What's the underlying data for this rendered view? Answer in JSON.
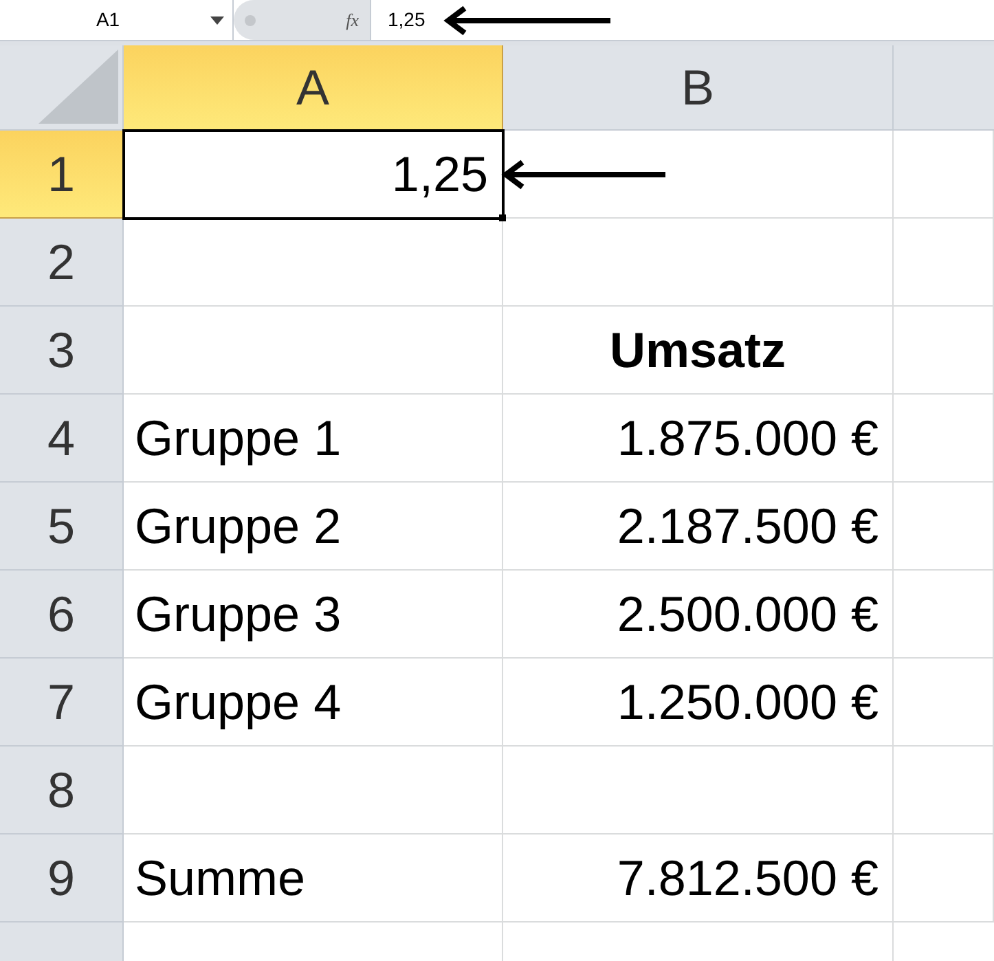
{
  "formula_bar": {
    "name_box": "A1",
    "function_button": "fx",
    "formula": "1,25"
  },
  "columns": [
    {
      "label": "A",
      "selected": true
    },
    {
      "label": "B",
      "selected": false
    }
  ],
  "rows": [
    {
      "number": "1",
      "selected": true,
      "cells": [
        {
          "text": "1,25",
          "kind": "number",
          "active": true
        }
      ]
    },
    {
      "number": "2",
      "selected": false,
      "cells": []
    },
    {
      "number": "3",
      "selected": false,
      "cells": [
        null,
        {
          "text": "Umsatz",
          "kind": "heading"
        }
      ]
    },
    {
      "number": "4",
      "selected": false,
      "cells": [
        {
          "text": "Gruppe 1",
          "kind": "label"
        },
        {
          "text": "1.875.000 €",
          "kind": "number"
        }
      ]
    },
    {
      "number": "5",
      "selected": false,
      "cells": [
        {
          "text": "Gruppe 2",
          "kind": "label"
        },
        {
          "text": "2.187.500 €",
          "kind": "number"
        }
      ]
    },
    {
      "number": "6",
      "selected": false,
      "cells": [
        {
          "text": "Gruppe 3",
          "kind": "label"
        },
        {
          "text": "2.500.000 €",
          "kind": "number"
        }
      ]
    },
    {
      "number": "7",
      "selected": false,
      "cells": [
        {
          "text": "Gruppe 4",
          "kind": "label"
        },
        {
          "text": "1.250.000 €",
          "kind": "number"
        }
      ]
    },
    {
      "number": "8",
      "selected": false,
      "cells": []
    },
    {
      "number": "9",
      "selected": false,
      "cells": [
        {
          "text": "Summe",
          "kind": "label"
        },
        {
          "text": "7.812.500 €",
          "kind": "number"
        }
      ]
    }
  ]
}
